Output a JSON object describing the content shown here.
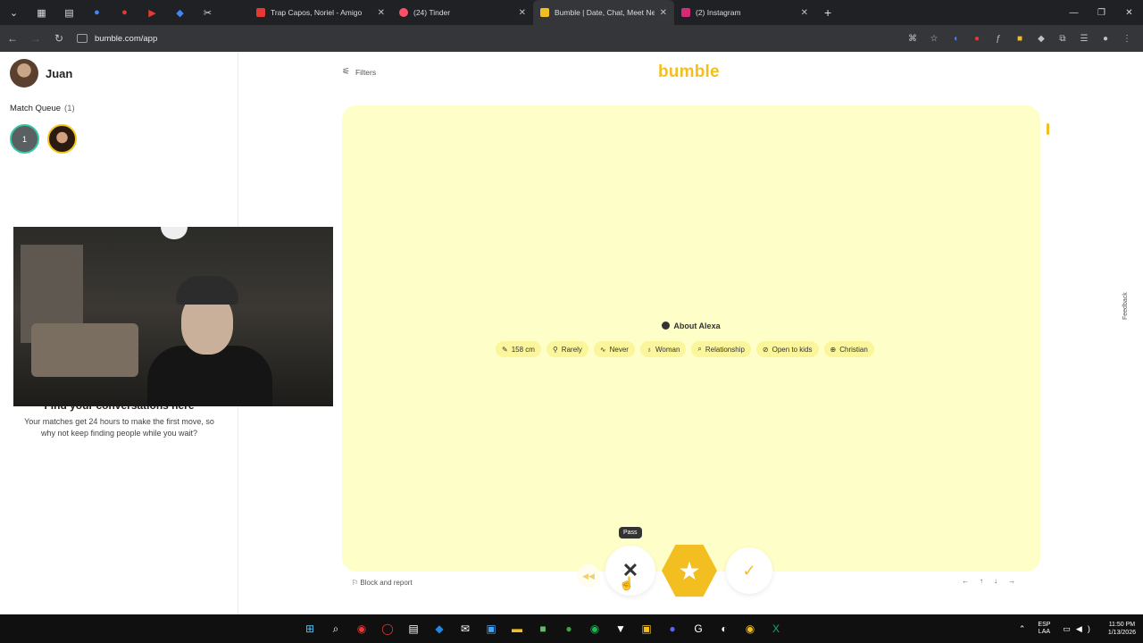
{
  "browser": {
    "tabs": [
      {
        "title": "Trap Capos, Noriel - Amigo",
        "favicon_color": "#e53935"
      },
      {
        "title": "(24) Tinder",
        "favicon_color": "#fd5068"
      },
      {
        "title": "Bumble | Date, Chat, Meet New",
        "favicon_color": "#f3bf20"
      },
      {
        "title": "(2) Instagram",
        "favicon_color": "#d62976"
      }
    ],
    "active_tab": 2,
    "url": "bumble.com/app"
  },
  "sidebar": {
    "user_name": "Juan",
    "match_queue_label": "Match Queue",
    "match_queue_count": "(1)",
    "queue_badge": "1",
    "empty_title": "Find your conversations here",
    "empty_text": "Your matches get 24 hours to make the first move, so why not keep finding people while you wait?"
  },
  "main": {
    "filters_label": "Filters",
    "logo": "bumble",
    "about_title": "About Alexa",
    "chips": [
      {
        "icon": "ruler-icon",
        "glyph": "✎",
        "label": "158 cm"
      },
      {
        "icon": "drink-icon",
        "glyph": "⚲",
        "label": "Rarely"
      },
      {
        "icon": "smoking-icon",
        "glyph": "∿",
        "label": "Never"
      },
      {
        "icon": "gender-icon",
        "glyph": "♁",
        "label": "Woman"
      },
      {
        "icon": "search-icon",
        "glyph": "⌕",
        "label": "Relationship"
      },
      {
        "icon": "kids-icon",
        "glyph": "⊘",
        "label": "Open to kids"
      },
      {
        "icon": "religion-icon",
        "glyph": "⊕",
        "label": "Christian"
      }
    ],
    "block_report": "Block and report",
    "tooltip": "Pass",
    "pager": [
      "←",
      "↑",
      "↓",
      "→"
    ],
    "feedback": "Feedback"
  },
  "taskbar": {
    "lang_top": "ESP",
    "lang_bottom": "LAA",
    "time": "11:50 PM",
    "date": "1/13/2026"
  }
}
